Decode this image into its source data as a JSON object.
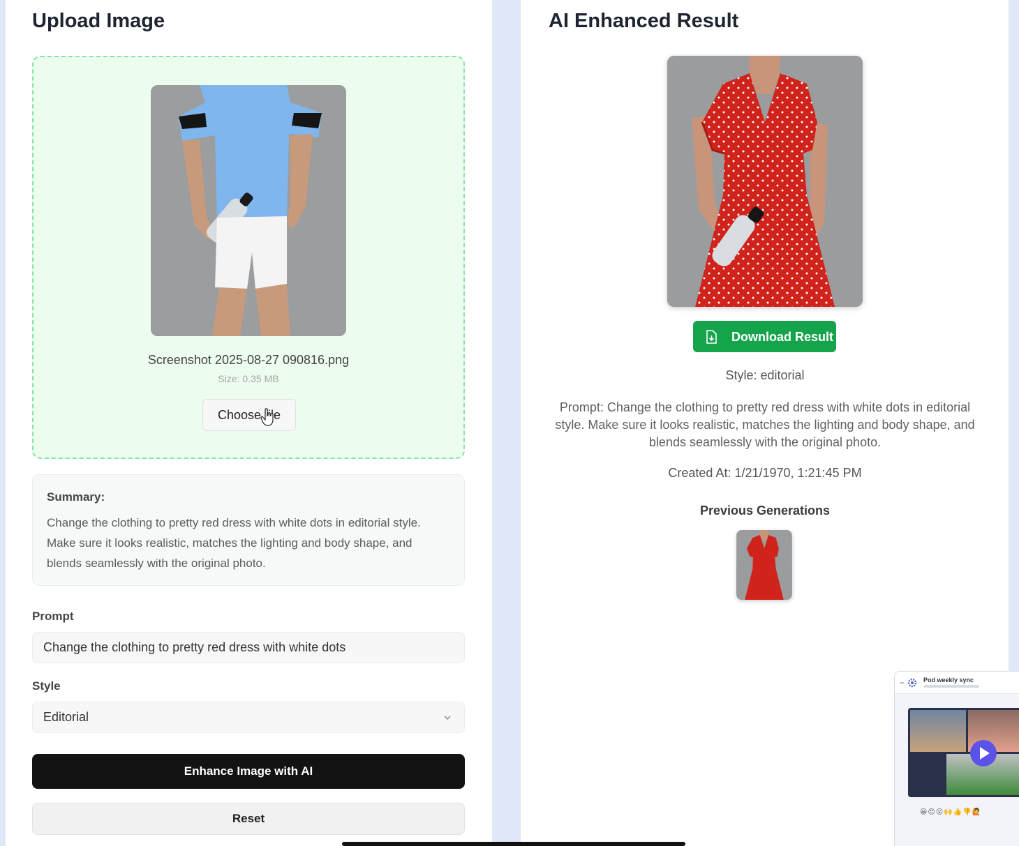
{
  "upload": {
    "title": "Upload Image",
    "file_name": "Screenshot 2025-08-27 090816.png",
    "file_size": "Size: 0.35 MB",
    "choose_button": "Choose file"
  },
  "summary": {
    "title": "Summary:",
    "text": "Change the clothing to pretty red dress with white dots in editorial style. Make sure it looks realistic, matches the lighting and body shape, and blends seamlessly with the original photo."
  },
  "form": {
    "prompt_label": "Prompt",
    "prompt_value": "Change the clothing to pretty red dress with white dots",
    "style_label": "Style",
    "style_value": "Editorial",
    "enhance_button": "Enhance Image with AI",
    "reset_button": "Reset"
  },
  "result": {
    "title": "AI Enhanced Result",
    "download_button": "Download Result",
    "style_text": "Style: editorial",
    "prompt_text": "Prompt: Change the clothing to pretty red dress with white dots in editorial style. Make sure it looks realistic, matches the lighting and body shape, and blends seamlessly with the original photo.",
    "created_text": "Created At: 1/21/1970, 1:21:45 PM",
    "previous_title": "Previous Generations"
  },
  "video_popup": {
    "title": "Pod weekly sync",
    "reactions": "😀😍😮🙌👍👎🙋"
  },
  "colors": {
    "accent_green": "#15a44b",
    "dropzone_bg": "#ecfcef",
    "dropzone_border": "#86e3a4",
    "primary_button": "#131313"
  },
  "icons": {
    "download": "download-file-icon",
    "cursor": "hand-pointer-icon",
    "chevron": "chevron-down-icon"
  }
}
